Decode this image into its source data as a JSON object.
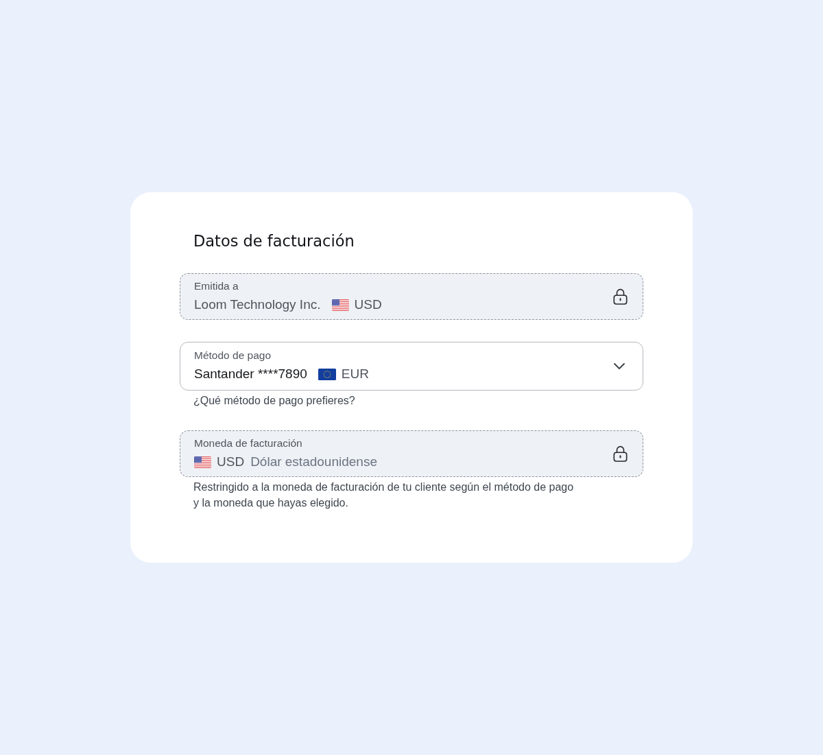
{
  "title": "Datos de facturación",
  "fields": [
    {
      "kind": "locked",
      "label": "Emitida a",
      "parts": [
        {
          "kind": "name",
          "text": "Loom Technology Inc."
        },
        {
          "kind": "flag_us"
        },
        {
          "kind": "code",
          "text": "USD"
        }
      ]
    },
    {
      "kind": "dropdown",
      "label": "Método de pago",
      "parts": [
        {
          "kind": "name",
          "text": "Santander ****7890"
        },
        {
          "kind": "flag_eu"
        },
        {
          "kind": "code",
          "text": "EUR"
        }
      ],
      "helper": "¿Qué método de pago prefieres?"
    },
    {
      "kind": "locked",
      "label": "Moneda de facturación",
      "parts": [
        {
          "kind": "flag_us"
        },
        {
          "kind": "code",
          "text": "USD"
        },
        {
          "kind": "description",
          "text": "Dólar estadounidense"
        }
      ],
      "helper": "Restringido a la moneda de facturación de tu cliente según el método de pago y la moneda que hayas elegido."
    }
  ]
}
